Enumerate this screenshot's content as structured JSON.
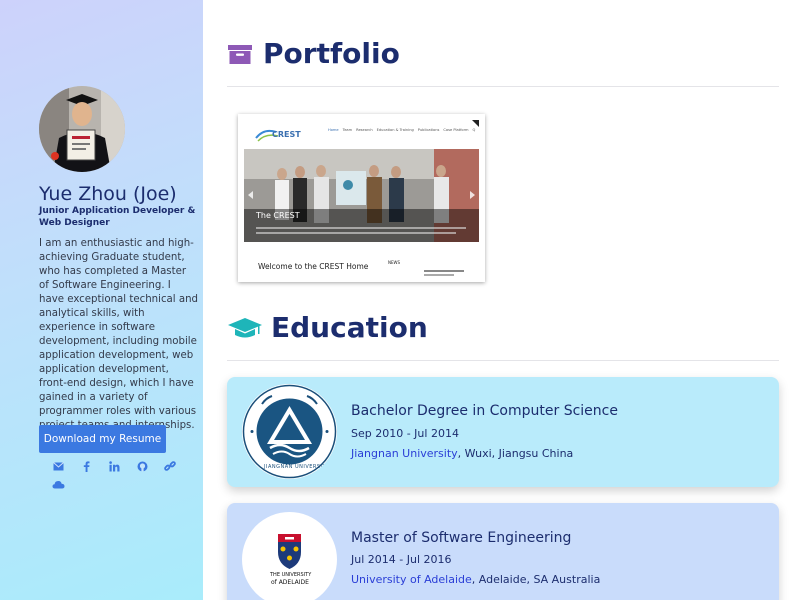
{
  "sidebar": {
    "name": "Yue Zhou (Joe)",
    "role": "Junior Application Developer & Web Designer",
    "bio": "I am an enthusiastic and high-achieving Graduate student, who has completed a Master of Software Engineering. I have exceptional technical and analytical skills, with experience in software development, including mobile application development, web application development, front-end design, which I have gained in a variety of programmer roles with various project teams and internships.",
    "resume_button": "Download my Resume",
    "social_icons": [
      "envelope-icon",
      "facebook-icon",
      "linkedin-icon",
      "github-icon",
      "link-icon",
      "cloud-icon"
    ]
  },
  "portfolio": {
    "title": "Portfolio",
    "items": [
      {
        "site_logo": "CREST",
        "nav": [
          "Home",
          "Team",
          "Research",
          "Education & Training",
          "Publications",
          "Case Platform",
          "Q"
        ],
        "slide_caption": "The CREST",
        "welcome": "Welcome to the CREST Home",
        "news_label": "NEWS"
      }
    ]
  },
  "education": {
    "title": "Education",
    "items": [
      {
        "degree": "Bachelor Degree in Computer Science",
        "dates": "Sep 2010 - Jul 2014",
        "school": "Jiangnan University",
        "location": ", Wuxi, Jiangsu China",
        "logo_text": "JIANGNAN UNIVERSITY",
        "bg": "#b9ebfb"
      },
      {
        "degree": "Master of Software Engineering",
        "dates": "Jul 2014 - Jul 2016",
        "school": "University of Adelaide",
        "location": ", Adelaide, SA Australia",
        "logo_text_top": "THE UNIVERSITY",
        "logo_text_bottom": "of ADELAIDE",
        "bg": "#c9dcfb"
      }
    ]
  },
  "colors": {
    "accent_blue": "#3b79e1",
    "title_navy": "#1c2d6e",
    "link_blue": "#2a3ed6",
    "portfolio_icon": "#8e59b6",
    "education_icon": "#1eb5b9"
  }
}
